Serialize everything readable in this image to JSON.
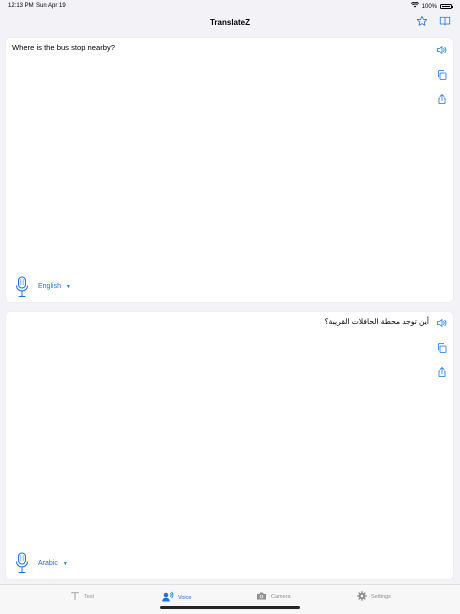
{
  "status_bar": {
    "time": "12:13 PM",
    "date": "Sun Apr 19",
    "battery": "100%"
  },
  "nav": {
    "title": "TranslateZ"
  },
  "source": {
    "text": "Where is the bus stop nearby?",
    "language": "English"
  },
  "target": {
    "text": "أين توجد محطة الحافلات القريبة؟",
    "language": "Arabic"
  },
  "tabs": [
    {
      "label": "Text",
      "icon": "text-icon",
      "active": false
    },
    {
      "label": "Voice",
      "icon": "voice-icon",
      "active": true
    },
    {
      "label": "Camera",
      "icon": "camera-icon",
      "active": false
    },
    {
      "label": "Settings",
      "icon": "gear-icon",
      "active": false
    }
  ],
  "colors": {
    "accent": "#1a73e8",
    "inactive": "#8e8e93",
    "background": "#f2f2f7"
  }
}
